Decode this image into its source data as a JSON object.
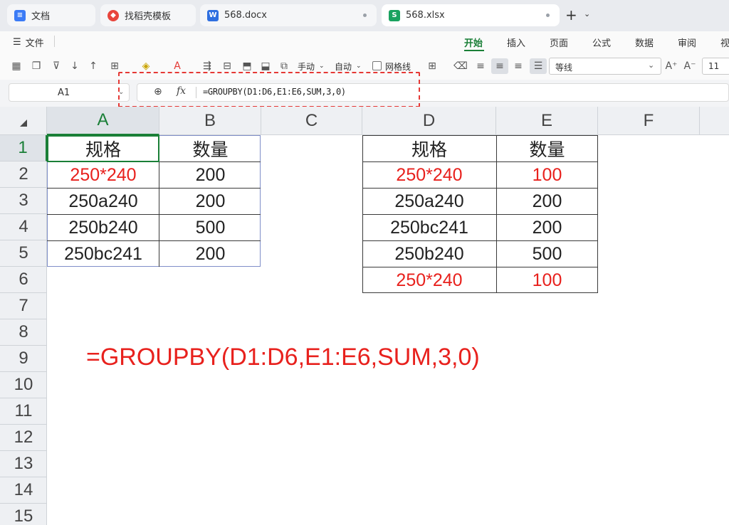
{
  "tabs": [
    {
      "label": "文档",
      "icon": "docs-icon",
      "color": "#3b7bf6"
    },
    {
      "label": "找稻壳模板",
      "icon": "docer-icon",
      "color": "#e8453c"
    },
    {
      "label": "568.docx",
      "icon": "word-icon",
      "color": "#2f6fe0",
      "icon_letter": "W"
    },
    {
      "label": "568.xlsx",
      "icon": "sheet-icon",
      "color": "#1aa260",
      "icon_letter": "S"
    }
  ],
  "menu": {
    "file": "文件",
    "items": [
      "开始",
      "插入",
      "页面",
      "公式",
      "数据",
      "审阅",
      "视"
    ],
    "active": "开始"
  },
  "toolbar": {
    "manual_label": "手动",
    "auto_label": "自动",
    "gridlines_label": "网格线",
    "font_name": "等线",
    "font_size": "11"
  },
  "formula_bar": {
    "cell_ref": "A1",
    "fx_label": "fx",
    "formula": "=GROUPBY(D1:D6,E1:E6,SUM,3,0)"
  },
  "columns": [
    "A",
    "B",
    "C",
    "D",
    "E",
    "F"
  ],
  "rows": [
    "1",
    "2",
    "3",
    "4",
    "5",
    "6",
    "7",
    "8",
    "9",
    "10",
    "11",
    "12",
    "13",
    "14",
    "15"
  ],
  "table_left": {
    "header": [
      "规格",
      "数量"
    ],
    "rows": [
      [
        "250*240",
        "200"
      ],
      [
        "250a240",
        "200"
      ],
      [
        "250b240",
        "500"
      ],
      [
        "250bc241",
        "200"
      ]
    ]
  },
  "table_right": {
    "header": [
      "规格",
      "数量"
    ],
    "rows": [
      [
        "250*240",
        "100"
      ],
      [
        "250a240",
        "200"
      ],
      [
        "250bc241",
        "200"
      ],
      [
        "250b240",
        "500"
      ],
      [
        "250*240",
        "100"
      ]
    ]
  },
  "annotation": "=GROUPBY(D1:D6,E1:E6,SUM,3,0)",
  "colors": {
    "accent": "#1a7f37",
    "highlight": "#e8211d"
  }
}
